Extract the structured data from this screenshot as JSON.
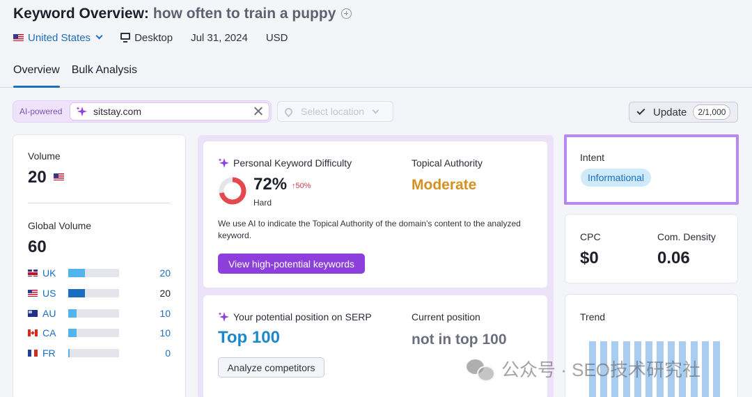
{
  "header": {
    "title": "Keyword Overview:",
    "keyword": "how often to train a puppy",
    "country": "United States",
    "device": "Desktop",
    "date": "Jul 31, 2024",
    "currency": "USD"
  },
  "tabs": [
    {
      "label": "Overview",
      "active": true
    },
    {
      "label": "Bulk Analysis",
      "active": false
    }
  ],
  "toolbar": {
    "ai_label": "AI-powered",
    "domain_value": "sitstay.com",
    "location_placeholder": "Select location",
    "update_label": "Update",
    "update_count": "2/1,000"
  },
  "volume_card": {
    "volume_label": "Volume",
    "volume_value": "20",
    "global_label": "Global Volume",
    "global_value": "60",
    "countries": [
      {
        "code": "UK",
        "value": "20",
        "fraction": 0.33,
        "color": "#52b4ec"
      },
      {
        "code": "US",
        "value": "20",
        "fraction": 0.33,
        "color": "#1a6ec2"
      },
      {
        "code": "AU",
        "value": "10",
        "fraction": 0.17,
        "color": "#52b4ec"
      },
      {
        "code": "CA",
        "value": "10",
        "fraction": 0.17,
        "color": "#52b4ec"
      },
      {
        "code": "FR",
        "value": "0",
        "fraction": 0.03,
        "color": "#52b4ec"
      }
    ]
  },
  "pkd_card": {
    "title": "Personal Keyword Difficulty",
    "value": "72%",
    "value_fraction": 0.72,
    "change": "↑50%",
    "level": "Hard",
    "authority_label": "Topical Authority",
    "authority_value": "Moderate",
    "description": "We use AI to indicate the Topical Authority of the domain's content to the analyzed keyword.",
    "button_label": "View high-potential keywords"
  },
  "serp_card": {
    "title": "Your potential position on SERP",
    "value": "Top 100",
    "current_label": "Current position",
    "current_value": "not in top 100",
    "button_label": "Analyze competitors"
  },
  "intent_card": {
    "label": "Intent",
    "badge": "Informational"
  },
  "cpc_card": {
    "cpc_label": "CPC",
    "cpc_value": "$0",
    "density_label": "Com. Density",
    "density_value": "0.06"
  },
  "trend_card": {
    "label": "Trend",
    "bars": [
      0.92,
      0.92,
      0.92,
      0.92,
      0.92,
      0.92,
      0.92,
      0.92,
      0.92,
      0.92,
      0.92,
      0.92
    ]
  },
  "watermark": "公众号 · SEO技术研究社",
  "colors": {
    "accent_blue": "#1a6ec2",
    "purple": "#8d3fdc",
    "donut_red": "#e5484d",
    "moderate_orange": "#d7901f"
  }
}
